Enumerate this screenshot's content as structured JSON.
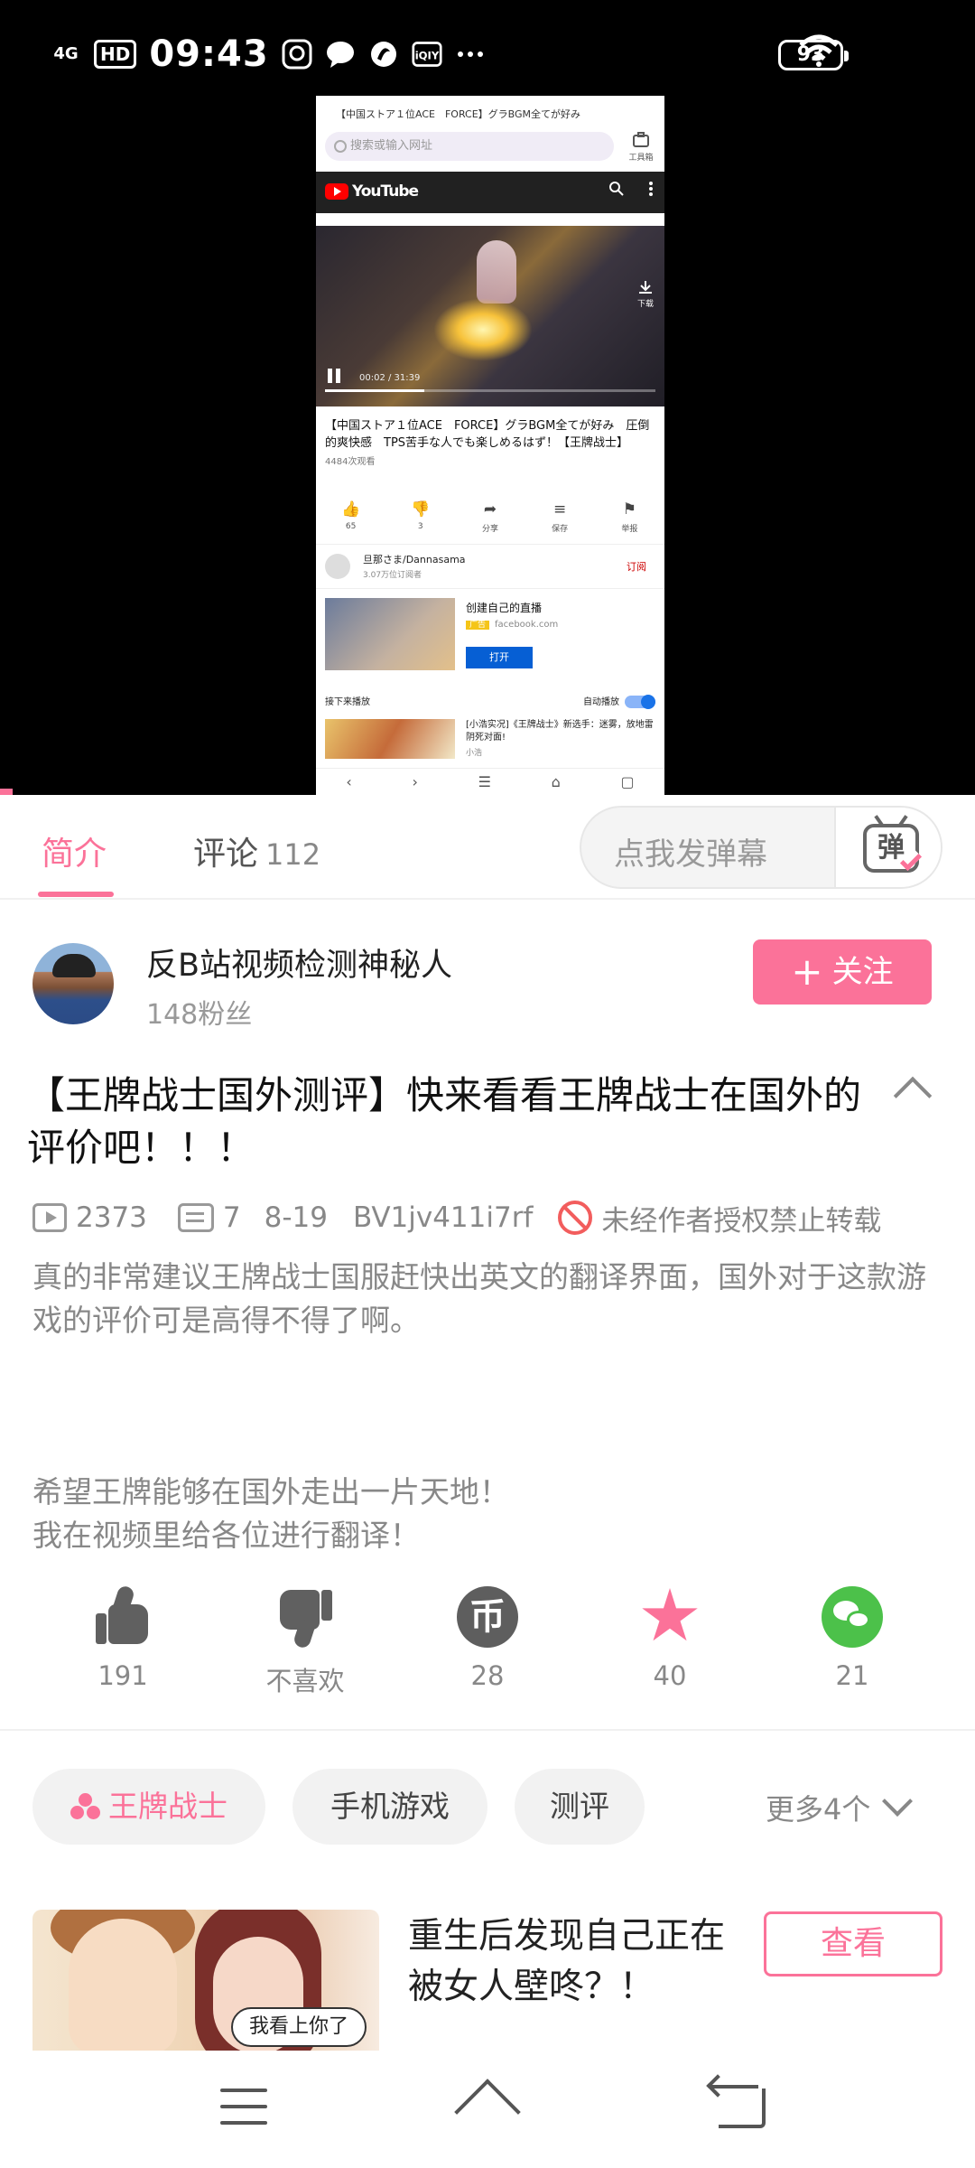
{
  "status_bar": {
    "time": "09:43",
    "network": "4G",
    "hd": "HD",
    "battery": "93",
    "icons": [
      "signal-icon",
      "hd-icon",
      "qq-icon",
      "message-icon",
      "browser-icon",
      "iqiyi-icon",
      "more-dots-icon",
      "wifi-icon",
      "battery-icon"
    ]
  },
  "video": {
    "recording": {
      "tab_title": "【中国ストア１位ACE　FORCE】グラBGM全てが好み",
      "address_placeholder": "搜索或输入网址",
      "tools_label": "工具箱",
      "youtube_label": "YouTube",
      "time_readout": "00:02 / 31:39",
      "video_title": "【中国ストア１位ACE　FORCE】グラBGM全てが好み　圧倒的爽快感　TPS苦手な人でも楽しめるはず！【王牌战士】",
      "views": "4484次观看",
      "actions": [
        {
          "icon": "like-icon",
          "label": "65"
        },
        {
          "icon": "dislike-icon",
          "label": "3"
        },
        {
          "icon": "share-icon",
          "label": "分享"
        },
        {
          "icon": "save-icon",
          "label": "保存"
        },
        {
          "icon": "flag-icon",
          "label": "举报"
        }
      ],
      "channel_name": "旦那さま/Dannasama",
      "channel_subs": "3.07万位订阅者",
      "subscribe_label": "订阅",
      "ad_title": "创建自己的直播",
      "ad_tag": "广告",
      "ad_domain": "facebook.com",
      "ad_open": "打开",
      "download_label": "下载",
      "up_next": "接下来播放",
      "autoplay": "自动播放",
      "next_title": "[小浩实况]《王牌战士》新选手：迷雾，放地雷阴死对面!",
      "next_channel": "小浩"
    },
    "progress": 0.001
  },
  "tabs": {
    "intro": "简介",
    "comments": "评论",
    "comments_count": "112",
    "danmaku_placeholder": "点我发弹幕",
    "danmaku_button": "弹"
  },
  "uploader": {
    "name": "反B站视频检测神秘人",
    "fans": "148粉丝",
    "follow_label": "关注",
    "follow_plus": "+"
  },
  "video_info": {
    "title": "【王牌战士国外测评】快来看看王牌战士在国外的评价吧！！！",
    "plays": "2373",
    "danmaku_count": "7",
    "date": "8-19",
    "bvid": "BV1jv411i7rf",
    "copyright": "未经作者授权禁止转载",
    "description_1": "真的非常建议王牌战士国服赶快出英文的翻译界面，国外对于这款游戏的评价可是高得不得了啊。",
    "description_2": "  希望王牌能够在国外走出一片天地！\n我在视频里给各位进行翻译！"
  },
  "action_bar": {
    "like": "191",
    "dislike": "不喜欢",
    "coin": "28",
    "coin_glyph": "币",
    "favorite": "40",
    "share": "21"
  },
  "tags": {
    "items": [
      "王牌战士",
      "手机游戏",
      "测评"
    ],
    "more": "更多4个"
  },
  "ad_card": {
    "title": "重生后发现自己正在被女人壁咚？！",
    "button": "查看",
    "thumb_caption": "我看上你了"
  },
  "colors": {
    "accent": "#fb7299",
    "wechat": "#4cc14a",
    "warning": "#f25d5d"
  }
}
